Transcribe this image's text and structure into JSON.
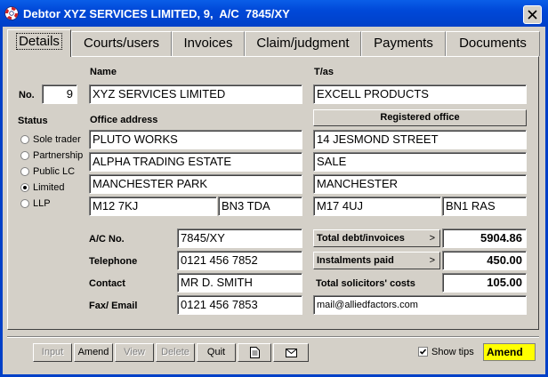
{
  "window": {
    "title": "Debtor XYZ SERVICES LIMITED, 9,  A/C  7845/XY",
    "icon": "lifebuoy-icon",
    "close_icon": "close-icon"
  },
  "tabs": [
    {
      "label": "Details",
      "active": true
    },
    {
      "label": "Courts/users"
    },
    {
      "label": "Invoices"
    },
    {
      "label": "Claim/judgment"
    },
    {
      "label": "Payments"
    },
    {
      "label": "Documents"
    }
  ],
  "debtor": {
    "no_label": "No.",
    "no_value": "9",
    "name_label": "Name",
    "name_value": "XYZ SERVICES LIMITED",
    "tas_label": "T/as",
    "tas_value": "EXCELL PRODUCTS",
    "status_label": "Status",
    "status_options": [
      {
        "label": "Sole trader",
        "checked": false
      },
      {
        "label": "Partnership",
        "checked": false
      },
      {
        "label": "Public LC",
        "checked": false
      },
      {
        "label": "Limited",
        "checked": true
      },
      {
        "label": "LLP",
        "checked": false
      }
    ],
    "office_address_label": "Office address",
    "office_address": [
      "PLUTO WORKS",
      "ALPHA TRADING ESTATE",
      "MANCHESTER PARK"
    ],
    "office_postcode": "M12 7KJ",
    "office_dx": "BN3 TDA",
    "registered_office_button": "Registered office",
    "registered_address": [
      "14 JESMOND STREET",
      "SALE",
      "MANCHESTER"
    ],
    "registered_postcode": "M17 4UJ",
    "registered_dx": "BN1 RAS"
  },
  "contact": {
    "ac_label": "A/C No.",
    "ac_value": "7845/XY",
    "telephone_label": "Telephone",
    "telephone_value": "0121 456 7852",
    "contact_label": "Contact",
    "contact_value": "MR D. SMITH",
    "fax_label": "Fax/ Email",
    "fax_value": "0121 456 7853",
    "email_value": "mail@alliedfactors.com"
  },
  "totals": {
    "debt_label": "Total debt/invoices",
    "debt_value": "5904.86",
    "instalments_label": "Instalments paid",
    "instalments_value": "450.00",
    "costs_label": "Total solicitors' costs",
    "costs_value": "105.00",
    "arrow": ">"
  },
  "toolbar": {
    "input": "Input",
    "amend": "Amend",
    "view": "View",
    "delete": "Delete",
    "quit": "Quit",
    "document_icon": "document-icon",
    "envelope_icon": "envelope-icon",
    "show_tips_label": "Show tips",
    "show_tips_checked": true,
    "mode": "Amend",
    "mode_color": "#ffff00"
  },
  "colors": {
    "titlebar": "#0048d8",
    "face": "#d4d0c8"
  }
}
